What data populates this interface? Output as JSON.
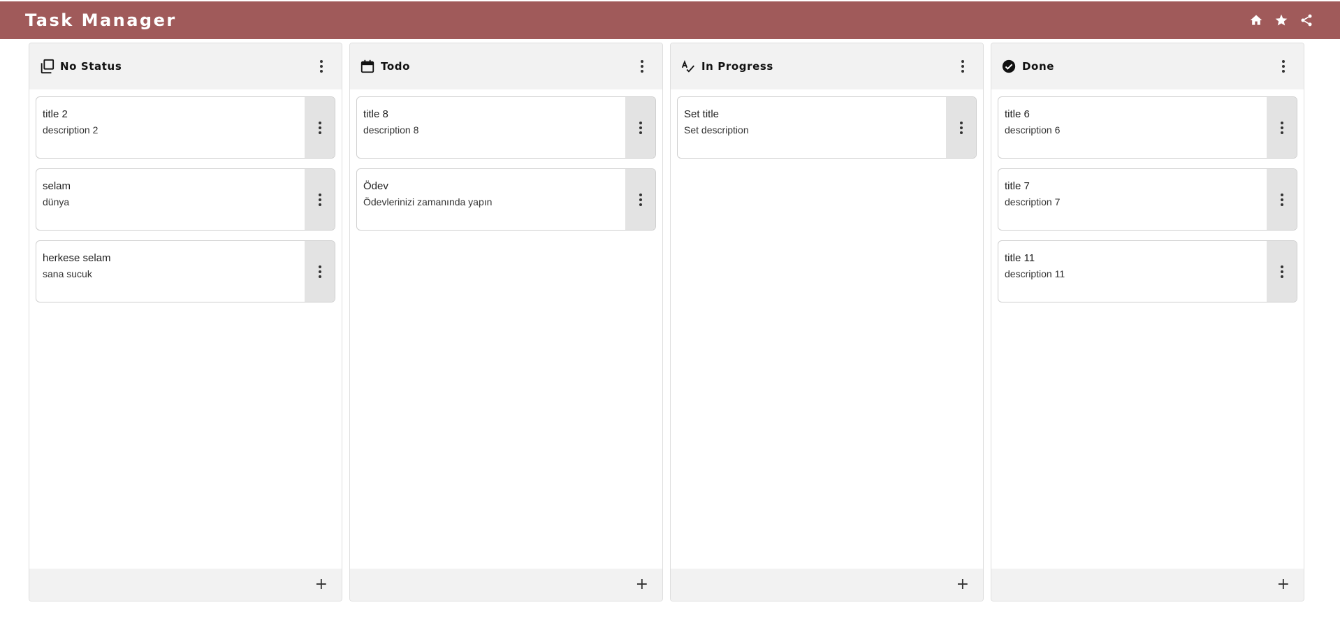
{
  "app": {
    "title": "Task Manager",
    "bar_color": "#a05a5a",
    "actions": [
      "home-icon",
      "star-icon",
      "share-icon"
    ]
  },
  "columns": [
    {
      "title": "No Status",
      "icon": "copy-icon",
      "cards": [
        {
          "title": "title 2",
          "description": "description 2"
        },
        {
          "title": "selam",
          "description": "dünya"
        },
        {
          "title": "herkese selam",
          "description": "sana sucuk"
        }
      ],
      "add_label": "+"
    },
    {
      "title": "Todo",
      "icon": "calendar-icon",
      "cards": [
        {
          "title": "title 8",
          "description": "description 8"
        },
        {
          "title": "Ödev",
          "description": "Ödevlerinizi zamanında yapın"
        }
      ],
      "add_label": "+"
    },
    {
      "title": "In Progress",
      "icon": "spellcheck-icon",
      "cards": [
        {
          "title": "Set title",
          "description": "Set description"
        }
      ],
      "add_label": "+"
    },
    {
      "title": "Done",
      "icon": "check-circle-icon",
      "cards": [
        {
          "title": "title 6",
          "description": "description 6"
        },
        {
          "title": "title 7",
          "description": "description 7"
        },
        {
          "title": "title 11",
          "description": "description 11"
        }
      ],
      "add_label": "+"
    }
  ]
}
